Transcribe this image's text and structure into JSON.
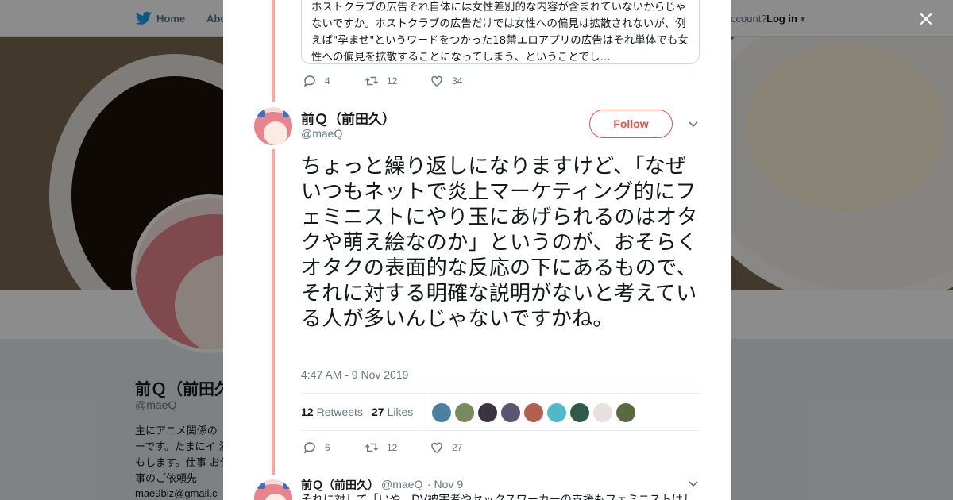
{
  "background": {
    "nav": {
      "home": "Home",
      "about": "Abo",
      "account_prompt": "ccount?",
      "login": "Log in"
    },
    "profile": {
      "name": "前Ｑ（前田久",
      "handle": "@maeQ",
      "bio": "主にアニメ関係の ーです。たまにイ 演もします。仕事 お仕事のご依頼先",
      "email": "mae9biz@gmail.c"
    }
  },
  "modal": {
    "close_icon": "×",
    "quoted_tweet": {
      "text": "ホストクラブの広告それ自体には女性差別的な内容が含まれていないからじゃないですか。ホストクラブの広告だけでは女性への偏見は拡散されないが、例えば\"孕ませ\"というワードをつかった18禁エロアプリの広告はそれ単体でも女性への偏見を拡散することになってしまう、ということでし…",
      "replies": "4",
      "retweets": "12",
      "likes": "34"
    },
    "main_tweet": {
      "author_name": "前Ｑ（前田久）",
      "author_handle": "@maeQ",
      "follow_label": "Follow",
      "text": "ちょっと繰り返しになりますけど、「なぜいつもネットで炎上マーケティング的にフェミニストにやり玉にあげられるのはオタクや萌え絵なのか」というのが、おそらくオタクの表面的な反応の下にあるもので、それに対する明確な説明がないと考えている人が多いんじゃないですかね。",
      "timestamp": "4:47 AM - 9 Nov 2019",
      "retweet_count": "12",
      "retweet_label": "Retweets",
      "like_count": "27",
      "like_label": "Likes",
      "replies": "6",
      "retweets": "12",
      "likes": "27"
    },
    "next_tweet": {
      "author_name": "前Ｑ（前田久）",
      "author_handle": "@maeQ",
      "date": "· Nov 9",
      "text": "それに対して「いや、DV被害者やセックスワーカーの支援もフェミニストはし"
    },
    "colors": {
      "accent": "#e0533f",
      "thread": "#f6a9a0",
      "muted": "#657786"
    },
    "liker_colors": [
      "#4a7fa0",
      "#7a8a60",
      "#3a3440",
      "#5b5570",
      "#b06050",
      "#52b8c8",
      "#2f5a48",
      "#e8e0e0",
      "#5a6a40"
    ]
  }
}
